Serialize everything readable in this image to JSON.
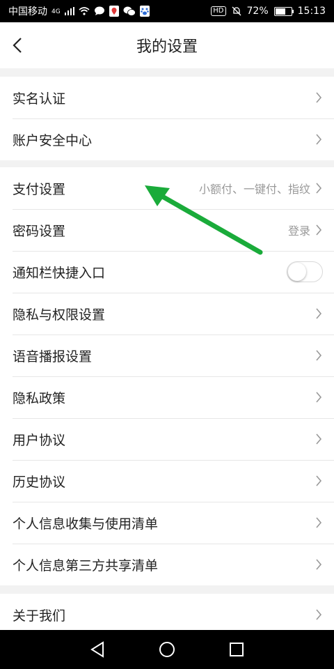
{
  "status_bar": {
    "carrier": "中国移动",
    "network": "4G",
    "hd": "HD",
    "battery": "72%",
    "battery_level": 0.72,
    "time": "15:13"
  },
  "header": {
    "title": "我的设置"
  },
  "groups": [
    {
      "items": [
        {
          "label": "实名认证"
        },
        {
          "label": "账户安全中心"
        }
      ]
    },
    {
      "items": [
        {
          "label": "支付设置",
          "value": "小额付、一键付、指纹"
        },
        {
          "label": "密码设置",
          "value": "登录"
        },
        {
          "label": "通知栏快捷入口",
          "toggle": false
        },
        {
          "label": "隐私与权限设置"
        },
        {
          "label": "语音播报设置"
        },
        {
          "label": "隐私政策"
        },
        {
          "label": "用户协议"
        },
        {
          "label": "历史协议"
        },
        {
          "label": "个人信息收集与使用清单"
        },
        {
          "label": "个人信息第三方共享清单"
        }
      ]
    },
    {
      "items": [
        {
          "label": "关于我们"
        }
      ]
    }
  ],
  "colors": {
    "annotation_arrow": "#1aab3a",
    "background": "#f2f2f2"
  }
}
